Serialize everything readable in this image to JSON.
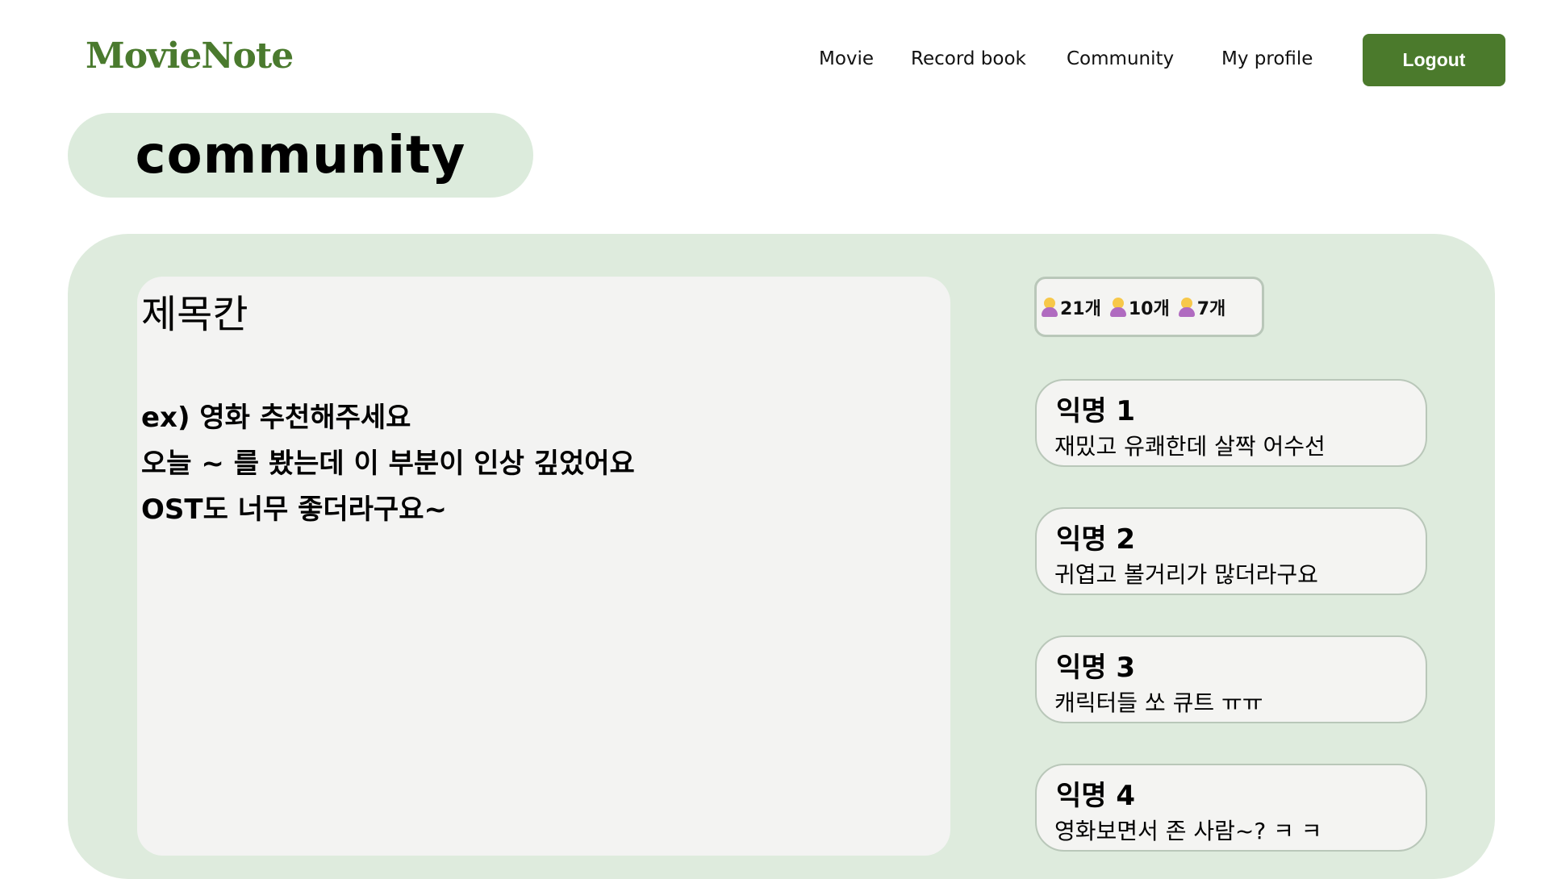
{
  "header": {
    "logo": "MovieNote",
    "nav": [
      "Movie",
      "Record book",
      "Community",
      "My profile"
    ],
    "logout_label": "Logout"
  },
  "page_title": "community",
  "post": {
    "title": "제목칸",
    "body_lines": [
      "ex) 영화 추천해주세요",
      "오늘 ~ 를 봤는데 이 부분이 인상 깊었어요",
      "OST도 너무 좋더라구요~"
    ]
  },
  "reactions": [
    {
      "icon": "person-raising-hand-icon",
      "count": "21개"
    },
    {
      "icon": "person-tipping-hand-icon",
      "count": "10개"
    },
    {
      "icon": "person-bowing-icon",
      "count": "7개"
    }
  ],
  "comments": [
    {
      "name": "익명 1",
      "text": "재밌고 유쾌한데 살짝 어수선"
    },
    {
      "name": "익명 2",
      "text": "귀엽고 볼거리가 많더라구요"
    },
    {
      "name": "익명 3",
      "text": "캐릭터들 쏘  큐트 ㅠㅠ"
    },
    {
      "name": "익명 4",
      "text": "영화보면서 존 사람~? ㅋ ㅋ"
    }
  ],
  "colors": {
    "brand": "#4a7a2e",
    "logout_bg": "#4b7a2c",
    "panel_bg": "#deebdd",
    "card_bg": "#f3f3f2",
    "card_border": "#b9c7b9"
  }
}
